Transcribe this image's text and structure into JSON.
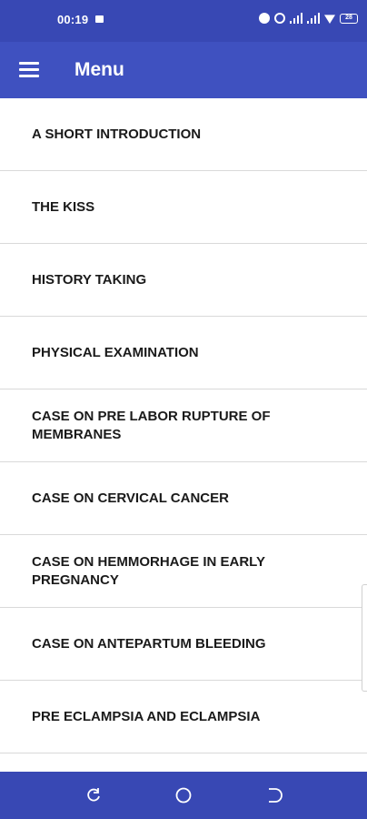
{
  "status_bar": {
    "time": "00:19",
    "battery": "28"
  },
  "app_bar": {
    "title": "Menu"
  },
  "menu": {
    "items": [
      {
        "label": "A SHORT INTRODUCTION"
      },
      {
        "label": "THE KISS"
      },
      {
        "label": "HISTORY TAKING"
      },
      {
        "label": "PHYSICAL EXAMINATION"
      },
      {
        "label": "CASE ON PRE LABOR RUPTURE OF MEMBRANES"
      },
      {
        "label": "CASE ON CERVICAL CANCER"
      },
      {
        "label": "CASE ON HEMMORHAGE IN EARLY PREGNANCY"
      },
      {
        "label": "CASE ON ANTEPARTUM BLEEDING"
      },
      {
        "label": "PRE ECLAMPSIA AND ECLAMPSIA"
      }
    ]
  },
  "colors": {
    "primary": "#3f51c0",
    "status": "#3848b4",
    "divider": "#d9d9d9",
    "text": "#1a1a1a"
  }
}
